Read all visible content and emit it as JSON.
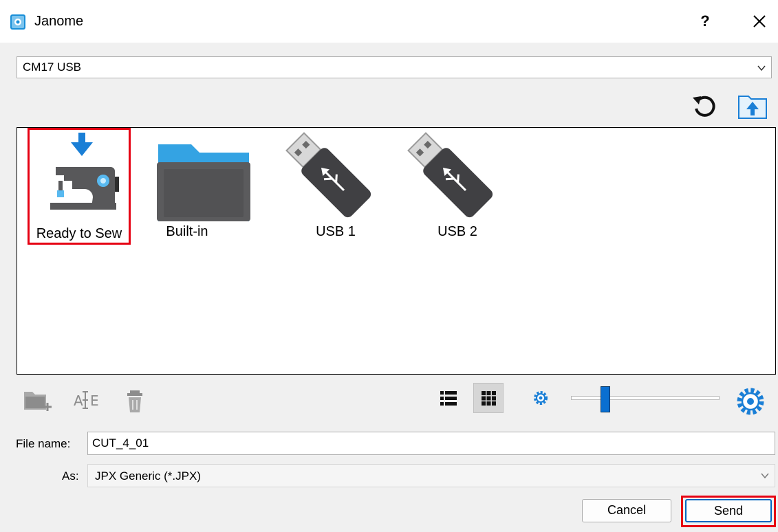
{
  "window": {
    "title": "Janome",
    "help_label": "?"
  },
  "device_select": {
    "value": "CM17 USB"
  },
  "items": [
    {
      "label": "Ready to Sew",
      "selected": true,
      "icon": "sewing-machine-icon"
    },
    {
      "label": "Built-in",
      "selected": false,
      "icon": "folder-icon"
    },
    {
      "label": "USB 1",
      "selected": false,
      "icon": "usb-drive-icon"
    },
    {
      "label": "USB 2",
      "selected": false,
      "icon": "usb-drive-icon"
    }
  ],
  "icons": {
    "refresh": "refresh-icon",
    "upload_folder": "upload-folder-icon",
    "new_folder": "new-folder-icon",
    "rename": "rename-icon",
    "delete": "trash-icon",
    "list_view": "list-view-icon",
    "grid_view": "grid-view-icon",
    "zoom_small": "gear-small-icon",
    "zoom_large": "gear-large-icon"
  },
  "icon_size_level": 0.23,
  "fields": {
    "file_name_label": "File name:",
    "file_name_value": "CUT_4_01",
    "as_label": "As:",
    "as_value": "JPX Generic (*.JPX)"
  },
  "buttons": {
    "cancel": "Cancel",
    "send": "Send"
  },
  "colors": {
    "highlight": "#e60012",
    "accent": "#0067c0",
    "folder": "#34a3e3",
    "icon_blue": "#1a7fd6"
  }
}
